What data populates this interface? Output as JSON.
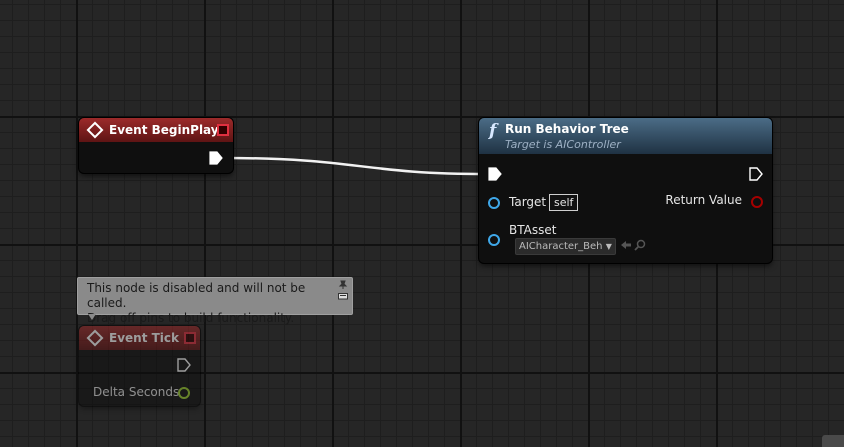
{
  "nodes": {
    "begin_play": {
      "title": "Event BeginPlay"
    },
    "run_behavior_tree": {
      "title": "Run Behavior Tree",
      "subtitle": "Target is AIController",
      "pins": {
        "target_label": "Target",
        "target_default": "self",
        "bt_asset_label": "BTAsset",
        "bt_asset_value": "AICharacter_Beh",
        "return_label": "Return Value"
      }
    },
    "event_tick": {
      "title": "Event Tick",
      "delta_label": "Delta Seconds"
    }
  },
  "tooltip": {
    "line1": "This node is disabled and will not be called.",
    "line2": "Drag off pins to build functionality."
  },
  "colors": {
    "event_header": "#9c2a2a",
    "function_header": "#3d5a73",
    "exec_wire": "#ffffff",
    "object_pin": "#3fa7e8",
    "bool_pin": "#a50000",
    "float_pin": "#9ed230",
    "grid_bg": "#262626"
  },
  "icons": {
    "event": "diamond-event-icon",
    "function": "function-f-icon",
    "delegate": "delegate-square-icon"
  }
}
